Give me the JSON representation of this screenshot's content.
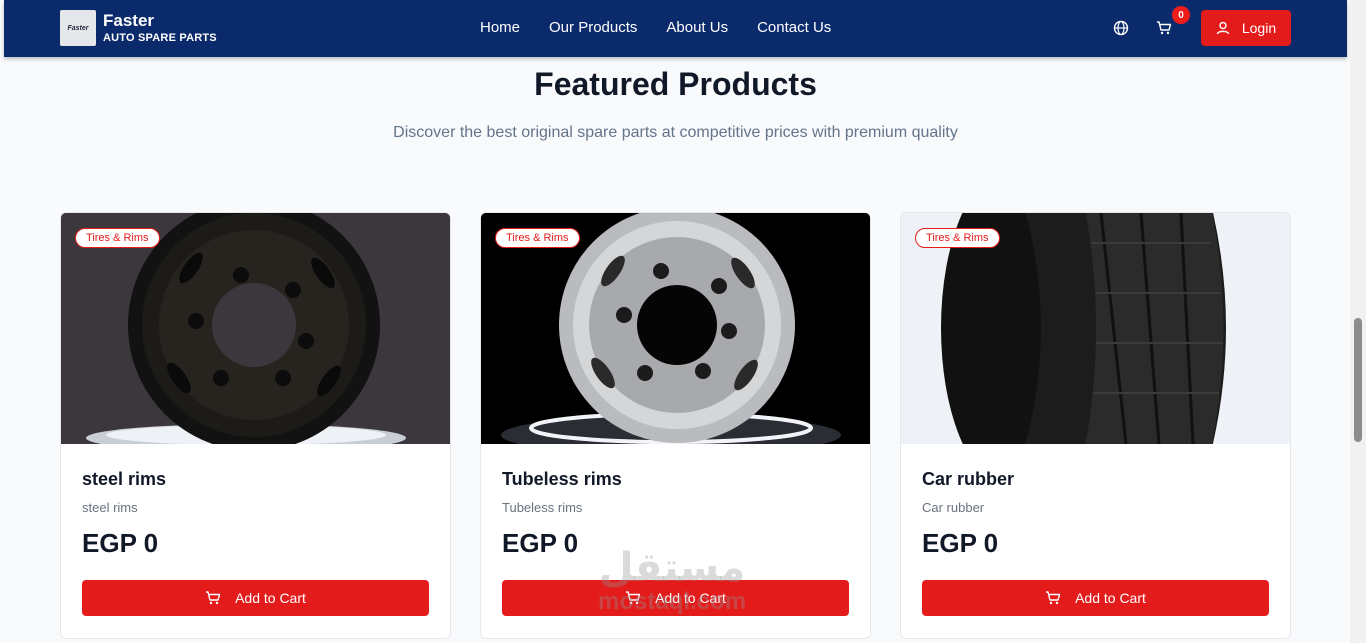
{
  "brand": {
    "name": "Faster",
    "tagline": "AUTO SPARE PARTS",
    "logo_text": "Faster"
  },
  "nav": {
    "items": [
      {
        "label": "Home"
      },
      {
        "label": "Our Products"
      },
      {
        "label": "About Us"
      },
      {
        "label": "Contact Us"
      }
    ]
  },
  "header": {
    "cart_count": "0",
    "login_label": "Login",
    "language_icon": "globe-icon",
    "cart_icon": "cart-icon"
  },
  "section": {
    "title": "Featured Products",
    "subtitle": "Discover the best original spare parts at competitive prices with premium quality"
  },
  "products": [
    {
      "category": "Tires & Rims",
      "name": "steel rims",
      "description": "steel rims",
      "price": "EGP 0",
      "button": "Add to Cart"
    },
    {
      "category": "Tires & Rims",
      "name": "Tubeless rims",
      "description": "Tubeless rims",
      "price": "EGP 0",
      "button": "Add to Cart"
    },
    {
      "category": "Tires & Rims",
      "name": "Car rubber",
      "description": "Car rubber",
      "price": "EGP 0",
      "button": "Add to Cart"
    }
  ],
  "watermark": {
    "arabic": "مستقل",
    "latin": "mostaql.com"
  },
  "colors": {
    "navbar": "#0b2a6b",
    "accent": "#e41b1b",
    "background": "#f8fafc"
  }
}
